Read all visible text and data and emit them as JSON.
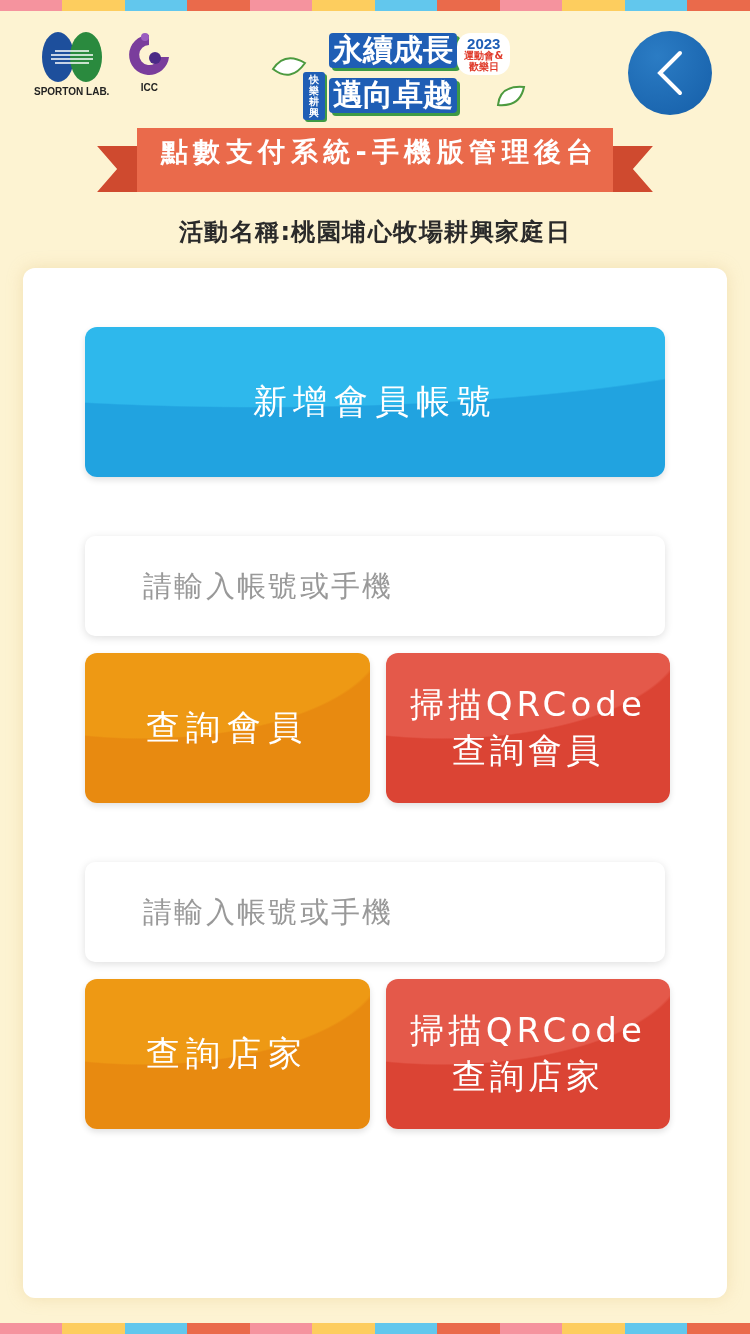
{
  "header": {
    "logos": [
      {
        "kind": "sporton",
        "label": "SPORTON LAB."
      },
      {
        "kind": "icc",
        "label": "ICC"
      }
    ],
    "event_logo": {
      "line_1": "永續成長",
      "line_2": "邁向卓越",
      "tag": "快樂耕興",
      "year": "2023",
      "badge_lines": [
        "運動會&",
        "歡樂日"
      ]
    },
    "title": "點數支付系統-手機版管理後台",
    "activity": "活動名稱:桃園埔心牧場耕興家庭日"
  },
  "add_member_button": "新增會員帳號",
  "sections": [
    {
      "placeholder": "請輸入帳號或手機",
      "buttons": [
        {
          "kind": "query",
          "lines": [
            "查詢會員"
          ]
        },
        {
          "kind": "scan",
          "lines": [
            "掃描QRCode",
            "查詢會員"
          ]
        }
      ]
    },
    {
      "placeholder": "請輸入帳號或手機",
      "buttons": [
        {
          "kind": "query",
          "lines": [
            "查詢店家"
          ]
        },
        {
          "kind": "scan",
          "lines": [
            "掃描QRCode",
            "查詢店家"
          ]
        }
      ]
    }
  ]
}
